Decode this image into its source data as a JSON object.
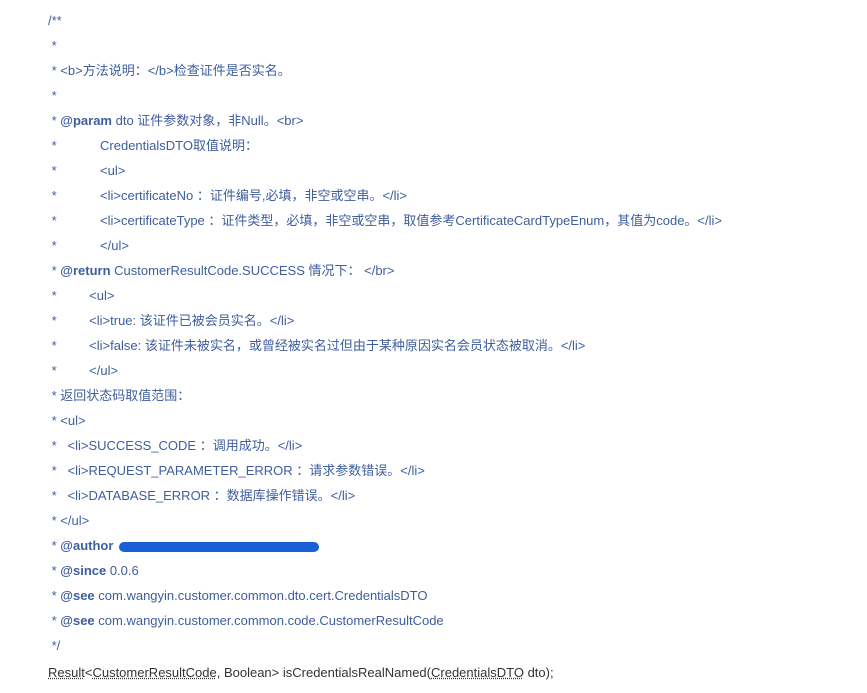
{
  "javadoc": {
    "l0": "/**",
    "l1": " *",
    "l2": " * <b>方法说明：</b>检查证件是否实名。",
    "l3": " *",
    "l4_pre": " * ",
    "l4_tag": "@param",
    "l4_post": " dto 证件参数对象，非Null。<br>",
    "l5": " *            CredentialsDTO取值说明：",
    "l6": " *            <ul>",
    "l7": " *            <li>certificateNo ：证件编号,必填，非空或空串。</li>",
    "l8": " *            <li>certificateType ：证件类型，必填，非空或空串，取值参考CertificateCardTypeEnum，其值为code。</li>",
    "l9": " *            </ul>",
    "l10_pre": " * ",
    "l10_tag": "@return",
    "l10_post": " CustomerResultCode.SUCCESS 情况下： </br>",
    "l11": " *         <ul>",
    "l12": " *         <li>true: 该证件已被会员实名。</li>",
    "l13": " *         <li>false: 该证件未被实名，或曾经被实名过但由于某种原因实名会员状态被取消。</li>",
    "l14": " *         </ul>",
    "l15": " * 返回状态码取值范围：",
    "l16": " * <ul>",
    "l17": " *   <li>SUCCESS_CODE ：调用成功。</li>",
    "l18": " *   <li>REQUEST_PARAMETER_ERROR ：请求参数错误。</li>",
    "l19": " *   <li>DATABASE_ERROR ：数据库操作错误。</li>",
    "l20": " * </ul>",
    "l21_pre": " * ",
    "l21_tag": "@author",
    "l21_post": " ",
    "l22_pre": " * ",
    "l22_tag": "@since",
    "l22_post": " 0.0.6",
    "l23_pre": " * ",
    "l23_tag": "@see",
    "l23_post": " com.wangyin.customer.common.dto.cert.CredentialsDTO",
    "l24_pre": " * ",
    "l24_tag": "@see",
    "l24_post": " com.wangyin.customer.common.code.CustomerResultCode",
    "l25": " */"
  },
  "signature": {
    "result": "Result",
    "lt": "<",
    "crc": "CustomerResultCode",
    "mid": ", Boolean> isCredentialsRealNamed(",
    "cdto": "CredentialsDTO",
    "end": " dto);"
  }
}
